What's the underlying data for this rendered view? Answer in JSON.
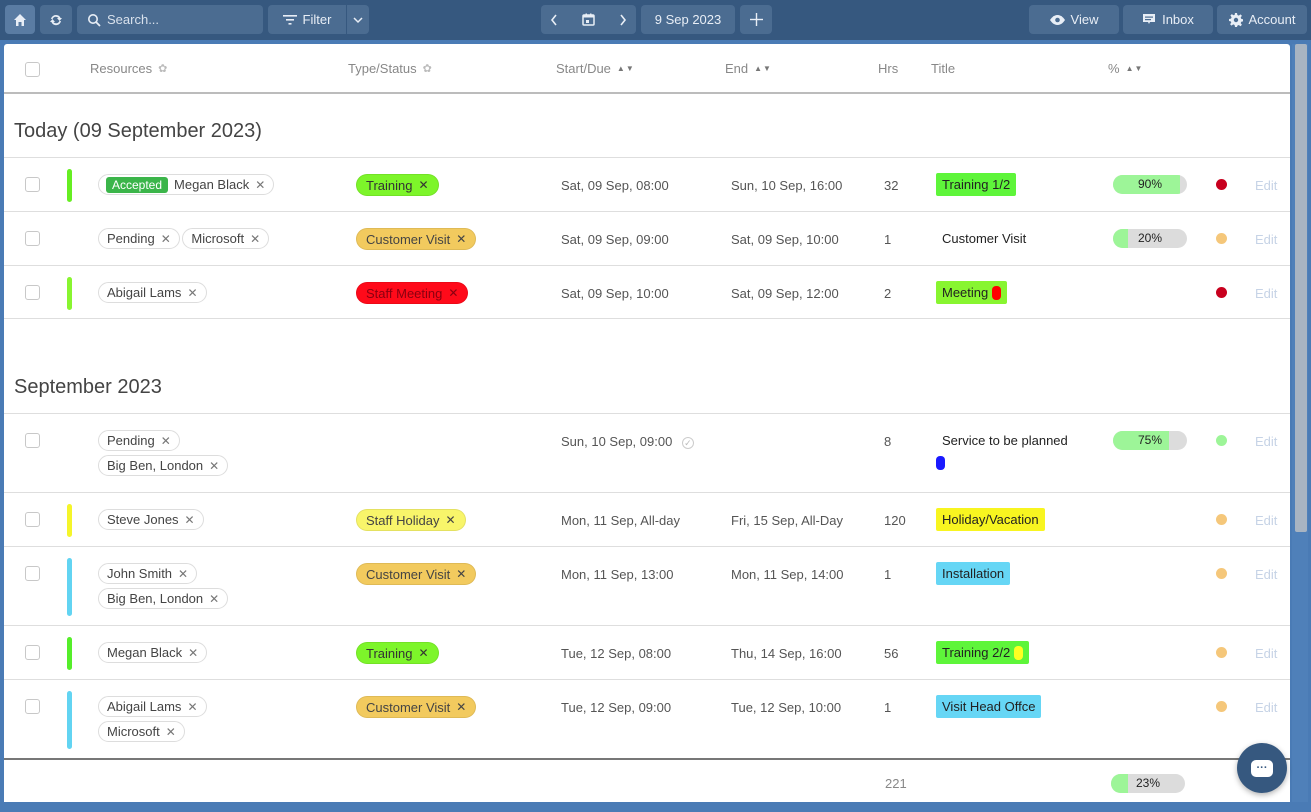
{
  "toolbar": {
    "search_placeholder": "Search...",
    "filter_label": "Filter",
    "date_label": "9 Sep 2023",
    "view_label": "View",
    "inbox_label": "Inbox",
    "account_label": "Account"
  },
  "columns": {
    "resources": "Resources",
    "type_status": "Type/Status",
    "start_due": "Start/Due",
    "end": "End",
    "hrs": "Hrs",
    "title": "Title",
    "percent": "%"
  },
  "sections": [
    {
      "title": "Today (09 September 2023)"
    },
    {
      "title": "September 2023"
    }
  ],
  "rows": [
    {
      "bar_color": "#66ee22",
      "resources": [
        {
          "badge": "Accepted",
          "label": "Megan Black"
        }
      ],
      "type": "Training",
      "type_color": "#7df52a",
      "type_text_color": "#333",
      "start": "Sat, 09 Sep, 08:00",
      "end": "Sun, 10 Sep, 16:00",
      "hrs": "32",
      "title": "Training 1/2",
      "title_bg": "#5ef53a",
      "progress": 90,
      "progress_label": "90%",
      "dot_color": "#c8001e",
      "edit": "Edit"
    },
    {
      "bar_color": "",
      "resources": [
        {
          "label": "Pending"
        },
        {
          "label": "Microsoft"
        }
      ],
      "type": "Customer Visit",
      "type_color": "#f2ca5e",
      "type_text_color": "#444",
      "start": "Sat, 09 Sep, 09:00",
      "end": "Sat, 09 Sep, 10:00",
      "hrs": "1",
      "title": "Customer Visit",
      "title_bg": "",
      "progress": 20,
      "progress_label": "20%",
      "dot_color": "#f5c77a",
      "edit": "Edit"
    },
    {
      "bar_color": "#88f530",
      "resources": [
        {
          "label": "Abigail Lams"
        }
      ],
      "type": "Staff Meeting",
      "type_color": "#ff0a1a",
      "type_text_color": "#8a0010",
      "start": "Sat, 09 Sep, 10:00",
      "end": "Sat, 09 Sep, 12:00",
      "hrs": "2",
      "title": "Meeting",
      "title_bg": "#88f530",
      "title_pill": "#ff0000",
      "dot_color": "#c8001e",
      "edit": "Edit"
    },
    {
      "bar_color": "",
      "resources": [
        {
          "label": "Pending"
        },
        {
          "label": "Big Ben, London"
        }
      ],
      "type": "",
      "start": "Sun, 10 Sep, 09:00",
      "start_icon": "check-circle-icon",
      "end": "",
      "hrs": "8",
      "title": "Service to be planned",
      "title_bg": "",
      "title_pill_below": "#1a1aff",
      "progress": 75,
      "progress_label": "75%",
      "dot_color": "#9df598",
      "edit": "Edit"
    },
    {
      "bar_color": "#f5f52a",
      "resources": [
        {
          "label": "Steve Jones"
        }
      ],
      "type": "Staff Holiday",
      "type_color": "#f8f56a",
      "type_text_color": "#444",
      "start": "Mon, 11 Sep, All-day",
      "end": "Fri, 15 Sep, All-Day",
      "hrs": "120",
      "title": "Holiday/Vacation",
      "title_bg": "#f8f520",
      "dot_color": "#f5c77a",
      "edit": "Edit"
    },
    {
      "bar_color": "#62d4f2",
      "resources": [
        {
          "label": "John Smith"
        },
        {
          "label": "Big Ben, London"
        }
      ],
      "type": "Customer Visit",
      "type_color": "#f2ca5e",
      "type_text_color": "#444",
      "start": "Mon, 11 Sep, 13:00",
      "end": "Mon, 11 Sep, 14:00",
      "hrs": "1",
      "title": "Installation",
      "title_bg": "#66d6f5",
      "dot_color": "#f5c77a",
      "edit": "Edit"
    },
    {
      "bar_color": "#55ee2a",
      "resources": [
        {
          "label": "Megan Black"
        }
      ],
      "type": "Training",
      "type_color": "#7df52a",
      "type_text_color": "#333",
      "start": "Tue, 12 Sep, 08:00",
      "end": "Thu, 14 Sep, 16:00",
      "hrs": "56",
      "title": "Training 2/2",
      "title_bg": "#5ef53a",
      "title_pill": "#ffff22",
      "dot_color": "#f5c77a",
      "edit": "Edit"
    },
    {
      "bar_color": "#62d4f2",
      "resources": [
        {
          "label": "Abigail Lams"
        },
        {
          "label": "Microsoft"
        }
      ],
      "type": "Customer Visit",
      "type_color": "#f2ca5e",
      "type_text_color": "#444",
      "start": "Tue, 12 Sep, 09:00",
      "end": "Tue, 12 Sep, 10:00",
      "hrs": "1",
      "title": "Visit Head Offce",
      "title_bg": "#66d6f5",
      "dot_color": "#f5c77a",
      "edit": "Edit"
    }
  ],
  "footer": {
    "total_hrs": "221",
    "progress": 23,
    "progress_label": "23%"
  }
}
